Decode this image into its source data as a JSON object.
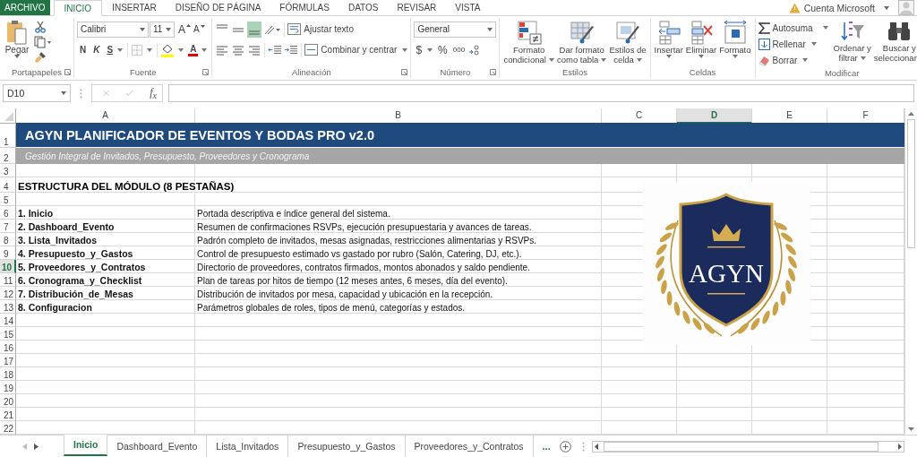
{
  "menu_tabs": [
    {
      "label": "ARCHIVO",
      "kind": "file",
      "selected": false
    },
    {
      "label": "INICIO",
      "kind": "tab",
      "selected": true
    },
    {
      "label": "INSERTAR",
      "kind": "tab",
      "selected": false
    },
    {
      "label": "DISEÑO DE PÁGINA",
      "kind": "tab",
      "selected": false
    },
    {
      "label": "FÓRMULAS",
      "kind": "tab",
      "selected": false
    },
    {
      "label": "DATOS",
      "kind": "tab",
      "selected": false
    },
    {
      "label": "REVISAR",
      "kind": "tab",
      "selected": false
    },
    {
      "label": "VISTA",
      "kind": "tab",
      "selected": false
    }
  ],
  "account": {
    "label": "Cuenta Microsoft"
  },
  "ribbon": {
    "clipboard": {
      "paste": "Pegar",
      "group_label": "Portapapeles"
    },
    "font": {
      "font_name": "Calibri",
      "font_size": "11",
      "grow": "A",
      "shrink": "A",
      "bold": "N",
      "italic": "K",
      "underline": "S",
      "font_color": "A",
      "group_label": "Fuente"
    },
    "alignment": {
      "bottom_align_on": true,
      "wrap_text": "Ajustar texto",
      "merge_center": "Combinar y centrar",
      "group_label": "Alineación"
    },
    "number": {
      "format": "General",
      "currency": "$",
      "percent": "%",
      "thousands": "000",
      "group_label": "Número"
    },
    "styles": {
      "buttons": [
        {
          "lines": [
            "Formato",
            "condicional"
          ]
        },
        {
          "lines": [
            "Dar formato",
            "como tabla"
          ]
        },
        {
          "lines": [
            "Estilos de",
            "celda"
          ]
        }
      ],
      "group_label": "Estilos"
    },
    "cells": {
      "buttons": [
        {
          "label": "Insertar"
        },
        {
          "label": "Eliminar"
        },
        {
          "label": "Formato"
        }
      ],
      "group_label": "Celdas"
    },
    "editing": {
      "autosum": "Autosuma",
      "fill": "Rellenar",
      "clear": "Borrar",
      "buttons": [
        {
          "lines": [
            "Ordenar y",
            "filtrar"
          ]
        },
        {
          "lines": [
            "Buscar y",
            "seleccionar"
          ]
        }
      ],
      "group_label": "Modificar"
    }
  },
  "formula_bar": {
    "name_box": "D10",
    "insert_function": "f$_{x}$"
  },
  "columns": [
    {
      "label": "A",
      "selected": false
    },
    {
      "label": "B",
      "selected": false
    },
    {
      "label": "C",
      "selected": false
    },
    {
      "label": "D",
      "selected": true
    },
    {
      "label": "E",
      "selected": false
    },
    {
      "label": "F",
      "selected": false
    }
  ],
  "rows": [
    {
      "number": "1",
      "selected": false,
      "kind": "title",
      "text": "AGYN PLANIFICADOR DE EVENTOS Y BODAS PRO v2.0"
    },
    {
      "number": "2",
      "selected": false,
      "kind": "subtitle",
      "text": "Gestión Integral de Invitados, Presupuesto, Proveedores y Cronograma"
    },
    {
      "number": "3",
      "selected": false,
      "kind": "empty"
    },
    {
      "number": "4",
      "selected": false,
      "kind": "heading",
      "text": "ESTRUCTURA DEL MÓDULO (8 PESTAÑAS)"
    },
    {
      "number": "5",
      "selected": false,
      "kind": "empty"
    },
    {
      "number": "6",
      "selected": false,
      "kind": "item",
      "name": "1. Inicio",
      "description": "Portada descriptiva e índice general del sistema."
    },
    {
      "number": "7",
      "selected": false,
      "kind": "item",
      "name": "2. Dashboard_Evento",
      "description": "Resumen de confirmaciones RSVPs, ejecución presupuestaria y avances de tareas."
    },
    {
      "number": "8",
      "selected": false,
      "kind": "item",
      "name": "3. Lista_Invitados",
      "description": "Padrón completo de invitados, mesas asignadas, restricciones alimentarias y RSVPs."
    },
    {
      "number": "9",
      "selected": false,
      "kind": "item",
      "name": "4. Presupuesto_y_Gastos",
      "description": "Control de presupuesto estimado vs gastado por rubro (Salón, Catering, DJ, etc.)."
    },
    {
      "number": "10",
      "selected": true,
      "kind": "item",
      "name": "5. Proveedores_y_Contratos",
      "description": "Directorio de proveedores, contratos firmados, montos abonados y saldo pendiente."
    },
    {
      "number": "11",
      "selected": false,
      "kind": "item",
      "name": "6. Cronograma_y_Checklist",
      "description": "Plan de tareas por hitos de tiempo (12 meses antes, 6 meses, día del evento)."
    },
    {
      "number": "12",
      "selected": false,
      "kind": "item",
      "name": "7. Distribución_de_Mesas",
      "description": "Distribución de invitados por mesa, capacidad y ubicación en la recepción."
    },
    {
      "number": "13",
      "selected": false,
      "kind": "item",
      "name": "8. Configuracion",
      "description": "Parámetros globales de roles, tipos de menú, categorías y estados."
    },
    {
      "number": "14",
      "selected": false,
      "kind": "empty"
    },
    {
      "number": "15",
      "selected": false,
      "kind": "empty"
    },
    {
      "number": "16",
      "selected": false,
      "kind": "empty"
    },
    {
      "number": "17",
      "selected": false,
      "kind": "empty"
    },
    {
      "number": "18",
      "selected": false,
      "kind": "empty"
    },
    {
      "number": "19",
      "selected": false,
      "kind": "empty"
    },
    {
      "number": "20",
      "selected": false,
      "kind": "empty"
    },
    {
      "number": "21",
      "selected": false,
      "kind": "empty"
    },
    {
      "number": "22",
      "selected": false,
      "kind": "empty"
    }
  ],
  "logo": {
    "text": "AGYN"
  },
  "sheet_tabs": [
    {
      "label": "Inicio",
      "selected": true
    },
    {
      "label": "Dashboard_Evento",
      "selected": false
    },
    {
      "label": "Lista_Invitados",
      "selected": false
    },
    {
      "label": "Presupuesto_y_Gastos",
      "selected": false
    },
    {
      "label": "Proveedores_y_Contratos",
      "selected": false
    }
  ],
  "more_sheets": "..."
}
